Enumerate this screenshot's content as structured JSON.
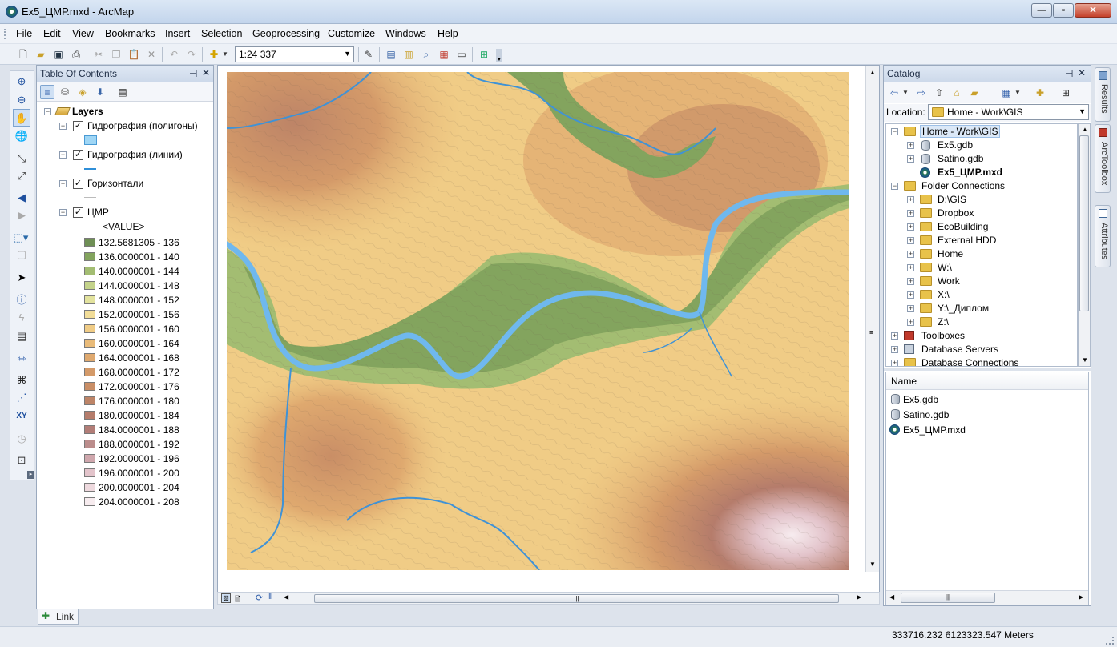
{
  "window": {
    "title": "Ex5_ЦМР.mxd - ArcMap"
  },
  "menu": [
    "File",
    "Edit",
    "View",
    "Bookmarks",
    "Insert",
    "Selection",
    "Geoprocessing",
    "Customize",
    "Windows",
    "Help"
  ],
  "toolbar": {
    "scale": "1:24 337"
  },
  "toc": {
    "title": "Table Of Contents",
    "root": "Layers",
    "layers": [
      {
        "name": "Гидрография (полигоны)"
      },
      {
        "name": "Гидрография (линии)"
      },
      {
        "name": "Горизонтали"
      },
      {
        "name": "ЦМР"
      }
    ],
    "value_label": "<VALUE>",
    "classes": [
      {
        "label": "132.5681305 - 136",
        "color": "#6f8f55"
      },
      {
        "label": "136.0000001 - 140",
        "color": "#83a45e"
      },
      {
        "label": "140.0000001 - 144",
        "color": "#a3bd72"
      },
      {
        "label": "144.0000001 - 148",
        "color": "#c4d38a"
      },
      {
        "label": "148.0000001 - 152",
        "color": "#e3e39e"
      },
      {
        "label": "152.0000001 - 156",
        "color": "#f2dd98"
      },
      {
        "label": "156.0000001 - 160",
        "color": "#f0cc86"
      },
      {
        "label": "160.0000001 - 164",
        "color": "#e9bb79"
      },
      {
        "label": "164.0000001 - 168",
        "color": "#dfa96f"
      },
      {
        "label": "168.0000001 - 172",
        "color": "#d49a69"
      },
      {
        "label": "172.0000001 - 176",
        "color": "#c98e66"
      },
      {
        "label": "176.0000001 - 180",
        "color": "#bd8467"
      },
      {
        "label": "180.0000001 - 184",
        "color": "#b57c6b"
      },
      {
        "label": "184.0000001 - 188",
        "color": "#b27d77"
      },
      {
        "label": "188.0000001 - 192",
        "color": "#bb8d8c"
      },
      {
        "label": "192.0000001 - 196",
        "color": "#cfa7ad"
      },
      {
        "label": "196.0000001 - 200",
        "color": "#e3c4cb"
      },
      {
        "label": "200.0000001 - 204",
        "color": "#eed9de"
      },
      {
        "label": "204.0000001 - 208",
        "color": "#f7ecef"
      }
    ],
    "link_tab": "Link"
  },
  "catalog": {
    "title": "Catalog",
    "location_label": "Location:",
    "location_value": "Home - Work\\GIS",
    "tree": [
      {
        "label": "Home - Work\\GIS",
        "level": 0,
        "icon": "folder-home-icon",
        "exp": "−",
        "sel": true
      },
      {
        "label": "Ex5.gdb",
        "level": 1,
        "icon": "database-icon",
        "exp": "+"
      },
      {
        "label": "Satino.gdb",
        "level": 1,
        "icon": "database-icon",
        "exp": "+"
      },
      {
        "label": "Ex5_ЦМР.mxd",
        "level": 1,
        "icon": "mxd-icon",
        "exp": "",
        "bold": true
      },
      {
        "label": "Folder Connections",
        "level": 0,
        "icon": "folder-icon",
        "exp": "−"
      },
      {
        "label": "D:\\GIS",
        "level": 1,
        "icon": "folder-icon",
        "exp": "+"
      },
      {
        "label": "Dropbox",
        "level": 1,
        "icon": "folder-icon",
        "exp": "+"
      },
      {
        "label": "EcoBuilding",
        "level": 1,
        "icon": "folder-icon",
        "exp": "+"
      },
      {
        "label": "External HDD",
        "level": 1,
        "icon": "folder-icon",
        "exp": "+"
      },
      {
        "label": "Home",
        "level": 1,
        "icon": "folder-icon",
        "exp": "+"
      },
      {
        "label": "W:\\",
        "level": 1,
        "icon": "folder-icon",
        "exp": "+"
      },
      {
        "label": "Work",
        "level": 1,
        "icon": "folder-icon",
        "exp": "+"
      },
      {
        "label": "X:\\",
        "level": 1,
        "icon": "folder-icon",
        "exp": "+"
      },
      {
        "label": "Y:\\_Диплом",
        "level": 1,
        "icon": "folder-icon",
        "exp": "+"
      },
      {
        "label": "Z:\\",
        "level": 1,
        "icon": "folder-icon",
        "exp": "+"
      },
      {
        "label": "Toolboxes",
        "level": 0,
        "icon": "toolbox-icon",
        "exp": "+"
      },
      {
        "label": "Database Servers",
        "level": 0,
        "icon": "server-icon",
        "exp": "+"
      },
      {
        "label": "Database Connections",
        "level": 0,
        "icon": "db-connections-icon",
        "exp": "+"
      }
    ],
    "contents_header": "Name",
    "contents": [
      {
        "label": "Ex5.gdb",
        "icon": "database-icon"
      },
      {
        "label": "Satino.gdb",
        "icon": "database-icon"
      },
      {
        "label": "Ex5_ЦМР.mxd",
        "icon": "mxd-icon"
      }
    ]
  },
  "side_tabs": [
    "Results",
    "ArcToolbox",
    "Attributes"
  ],
  "status": {
    "coords": "333716.232  6123323.547 Meters"
  }
}
